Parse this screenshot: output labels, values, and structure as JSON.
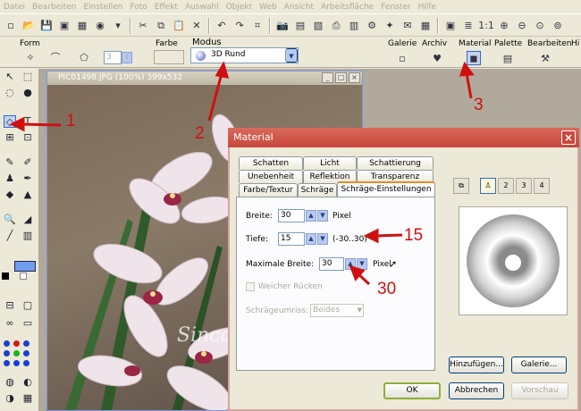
{
  "menu": [
    "Datei",
    "Bearbeiten",
    "Einstellen",
    "Foto",
    "Effekt",
    "Auswahl",
    "Objekt",
    "Web",
    "Ansicht",
    "Arbeitsfläche",
    "Fenster",
    "Hilfe"
  ],
  "toolbar2": {
    "form_label": "Form",
    "form_spin_value": "3",
    "farbe_label": "Farbe",
    "modus_label": "Modus",
    "modus_value": "3D Rund",
    "galerie_label": "Galerie",
    "archiv_label": "Archiv",
    "material_label": "Material",
    "palette_label": "Palette",
    "bearbeiten_label": "Bearbeiten",
    "hi_label": "Hi"
  },
  "image_window": {
    "title": "PIC01498.JPG (100%) 399x532"
  },
  "dialog": {
    "title": "Material",
    "tabs_row1": [
      "Schatten",
      "Licht",
      "Schattierung"
    ],
    "tabs_row2": [
      "Unebenheit",
      "Reflektion",
      "Transparenz"
    ],
    "tabs_row3": [
      "Farbe/Textur",
      "Schräge",
      "Schräge-Einstellungen"
    ],
    "breite_label": "Breite:",
    "breite_value": "30",
    "breite_unit": "Pixel",
    "tiefe_label": "Tiefe:",
    "tiefe_value": "15",
    "tiefe_range": "(-30..30)",
    "maxbreite_label": "Maximale Breite:",
    "maxbreite_value": "30",
    "maxbreite_unit": "Pixel",
    "weicher_label": "Weicher Rücken",
    "schraegeumriss_label": "Schrägeumriss:",
    "schraegeumriss_value": "Beides",
    "hinzufuegen_label": "Hinzufügen...",
    "galerie_label": "Galerie...",
    "ok_label": "OK",
    "abbrechen_label": "Abbrechen",
    "vorschau_label": "Vorschau",
    "light_buttons": [
      "2",
      "3",
      "4"
    ]
  },
  "annotations": [
    "1",
    "2",
    "3",
    "15",
    "30"
  ],
  "colors": {
    "dialog_title": "#c8473c",
    "annotation": "#d01010",
    "active_tab_accent": "#e68b2c"
  }
}
